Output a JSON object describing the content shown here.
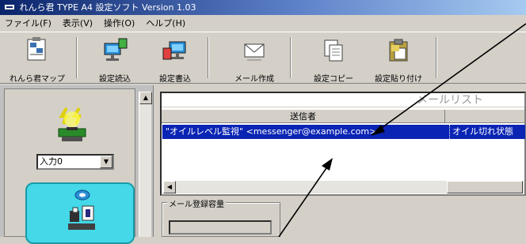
{
  "window": {
    "title": "れんら君 TYPE A4 設定ソフト Version 1.03"
  },
  "menu": {
    "items": [
      "ファイル(F)",
      "表示(V)",
      "操作(O)",
      "ヘルプ(H)"
    ]
  },
  "toolbar": {
    "buttons": [
      {
        "id": "map",
        "label": "れんら君マップ",
        "icon": "map-icon"
      },
      {
        "id": "read",
        "label": "設定読込",
        "icon": "read-settings-icon"
      },
      {
        "id": "write",
        "label": "設定書込",
        "icon": "write-settings-icon"
      },
      {
        "id": "mail",
        "label": "メール作成",
        "icon": "mail-icon"
      },
      {
        "id": "copy",
        "label": "設定コピー",
        "icon": "copy-icon"
      },
      {
        "id": "paste",
        "label": "設定貼り付け",
        "icon": "paste-icon"
      }
    ]
  },
  "left_panel": {
    "input_select": {
      "value": "入力0"
    }
  },
  "mail_list": {
    "title": "メールリスト",
    "column_sender": "送信者",
    "rows": [
      {
        "sender": "\"オイルレベル監視\" <messenger@example.com>",
        "subject": "オイル切れ状態"
      }
    ]
  },
  "storage": {
    "legend": "メール登録容量"
  },
  "colors": {
    "selection": "#0a24b4",
    "device_panel": "#44d8e8",
    "title_bar": "#0a246a"
  }
}
